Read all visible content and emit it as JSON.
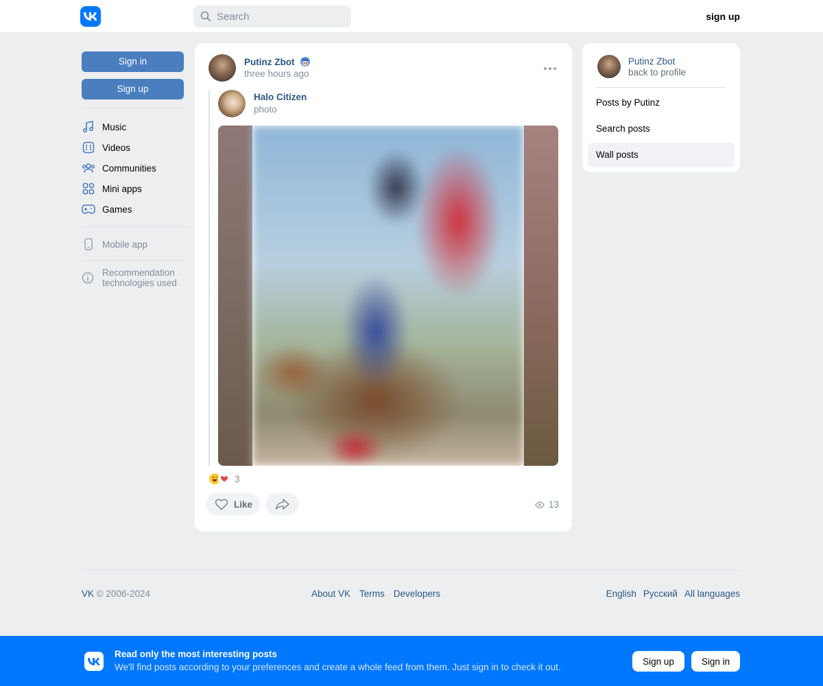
{
  "header": {
    "search_placeholder": "Search",
    "signup": "sign up"
  },
  "sidebar": {
    "sign_in": "Sign in",
    "sign_up": "Sign up",
    "items": [
      {
        "label": "Music",
        "icon": "music-icon"
      },
      {
        "label": "Videos",
        "icon": "video-icon"
      },
      {
        "label": "Communities",
        "icon": "communities-icon"
      },
      {
        "label": "Mini apps",
        "icon": "mini-apps-icon"
      },
      {
        "label": "Games",
        "icon": "gamepad-icon"
      }
    ],
    "mobile_app": "Mobile app",
    "recommendation_line1": "Recommendation",
    "recommendation_line2": "technologies used"
  },
  "post": {
    "author": "Putinz Zbot",
    "time": "three hours ago",
    "repost_author": "Halo Citizen",
    "repost_subtitle": "photo",
    "reactions_count": "3",
    "like_label": "Like",
    "views": "13"
  },
  "right": {
    "profile_name": "Putinz Zbot",
    "back_label": "back to profile",
    "menu": [
      {
        "label": "Posts by Putinz",
        "active": false
      },
      {
        "label": "Search posts",
        "active": false
      },
      {
        "label": "Wall posts",
        "active": true
      }
    ]
  },
  "footer": {
    "brand": "VK",
    "copyright": " © 2006-2024",
    "about": "About VK",
    "terms": "Terms",
    "developers": "Developers",
    "lang_en": "English",
    "lang_ru": "Русский",
    "lang_all": "All languages"
  },
  "banner": {
    "title": "Read only the most interesting posts",
    "subtitle": "We'll find posts according to your preferences and create a whole feed from them. Just sign in to check it out.",
    "signup": "Sign up",
    "signin": "Sign in"
  },
  "colors": {
    "brand": "#0077ff",
    "link": "#2a5885",
    "background": "#edeef0",
    "button": "#4a7ebf"
  }
}
